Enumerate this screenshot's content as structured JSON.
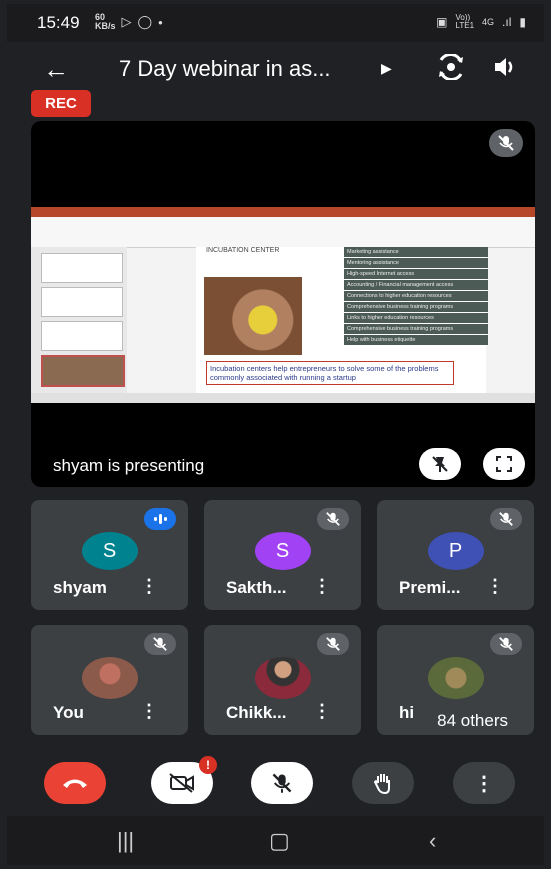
{
  "status_bar": {
    "time": "15:49",
    "speed": "60 KB/s",
    "icons": [
      "speed-indicator",
      "play-icon",
      "whatsapp-icon",
      "dot-icon"
    ],
    "right_icons": [
      "screenshot-icon",
      "volte-icon",
      "4g-icon",
      "signal-icon",
      "battery-icon"
    ],
    "network": "4G",
    "volte": "Vo)) LTE1"
  },
  "header": {
    "back_icon": "arrow-back-icon",
    "title": "7 Day webinar in as...",
    "title_arrow_icon": "play-arrow-icon",
    "switch_camera_icon": "camera-switch-icon",
    "speaker_icon": "speaker-icon"
  },
  "rec_label": "REC",
  "presentation": {
    "presenter_text": "shyam is presenting",
    "slide": {
      "heading": "INCUBATION CENTER",
      "bullets": [
        "Marketing assistance",
        "Mentoring assistance",
        "High-speed Internet access",
        "Accounting / Financial management access",
        "Connections to higher education resources",
        "Comprehensive business training programs",
        "Links to higher education resources",
        "Comprehensive business training programs",
        "Help with business etiquette"
      ],
      "caption": "Incubation centers help entrepreneurs to solve some of the problems commonly associated with running a startup"
    },
    "muted_icon": "mic-off-icon",
    "pin_icon": "pin-off-icon",
    "fullscreen_icon": "fullscreen-icon"
  },
  "participants": [
    {
      "name": "shyam",
      "initial": "S",
      "color": "#00838f",
      "speaking": true
    },
    {
      "name": "Sakth...",
      "initial": "S",
      "color": "#a142f4",
      "speaking": false
    },
    {
      "name": "Premi...",
      "initial": "P",
      "color": "#3f51b5",
      "speaking": false
    },
    {
      "name": "You",
      "initial": "",
      "color": "#8b5a4a",
      "speaking": false
    },
    {
      "name": "Chikk...",
      "initial": "",
      "color": "#6b3a3a",
      "speaking": false
    },
    {
      "name": "hi",
      "initial": "",
      "color": "#7a6a4a",
      "speaking": false
    }
  ],
  "others_label": "84 others",
  "controls": {
    "end_call_icon": "phone-hangup-icon",
    "camera_icon": "camera-off-icon",
    "camera_badge": "!",
    "mic_icon": "mic-off-icon",
    "hand_icon": "hand-raise-icon",
    "more_icon": "more-vert-icon"
  },
  "navigation": {
    "recents_icon": "recents-icon",
    "home_icon": "home-icon",
    "back_icon": "nav-back-icon"
  }
}
